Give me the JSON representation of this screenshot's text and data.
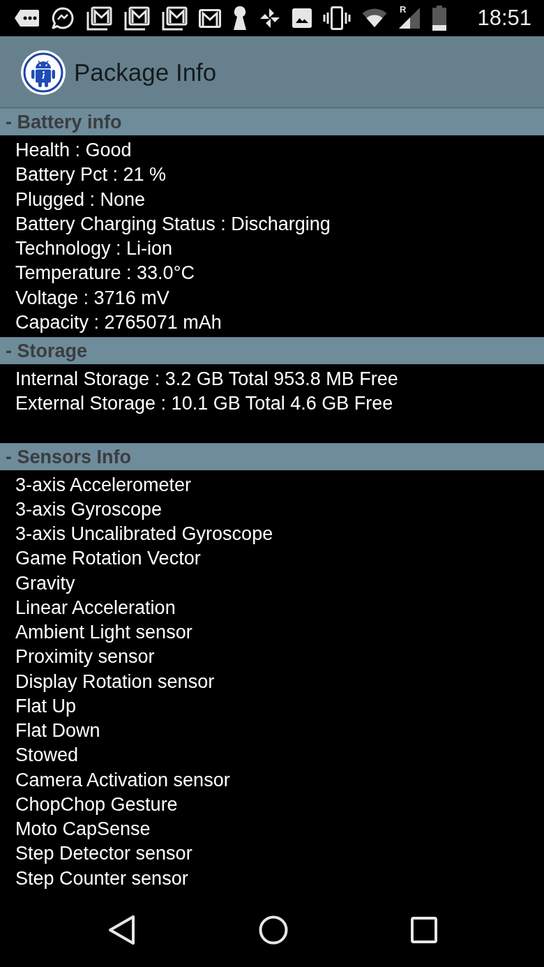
{
  "status_bar": {
    "roaming_indicator": "R",
    "time": "18:51"
  },
  "app_bar": {
    "title": "Package Info"
  },
  "sections": [
    {
      "title": "- Battery info",
      "items": [
        "Health : Good",
        "Battery Pct : 21 %",
        "Plugged : None",
        "Battery Charging Status : Discharging",
        "Technology : Li-ion",
        "Temperature : 33.0°C",
        "Voltage : 3716 mV",
        "Capacity : 2765071 mAh"
      ]
    },
    {
      "title": "- Storage",
      "items": [
        "Internal Storage : 3.2 GB Total 953.8 MB Free",
        "External Storage : 10.1 GB Total 4.6 GB Free"
      ]
    },
    {
      "title": "- Sensors Info",
      "items": [
        "3-axis Accelerometer",
        "3-axis Gyroscope",
        "3-axis Uncalibrated Gyroscope",
        "Game Rotation Vector",
        "Gravity",
        "Linear Acceleration",
        "Ambient Light sensor",
        "Proximity sensor",
        "Display Rotation sensor",
        "Flat Up",
        "Flat Down",
        "Stowed",
        "Camera Activation sensor",
        "ChopChop Gesture",
        "Moto CapSense",
        "Step Detector sensor",
        "Step Counter sensor"
      ]
    }
  ]
}
